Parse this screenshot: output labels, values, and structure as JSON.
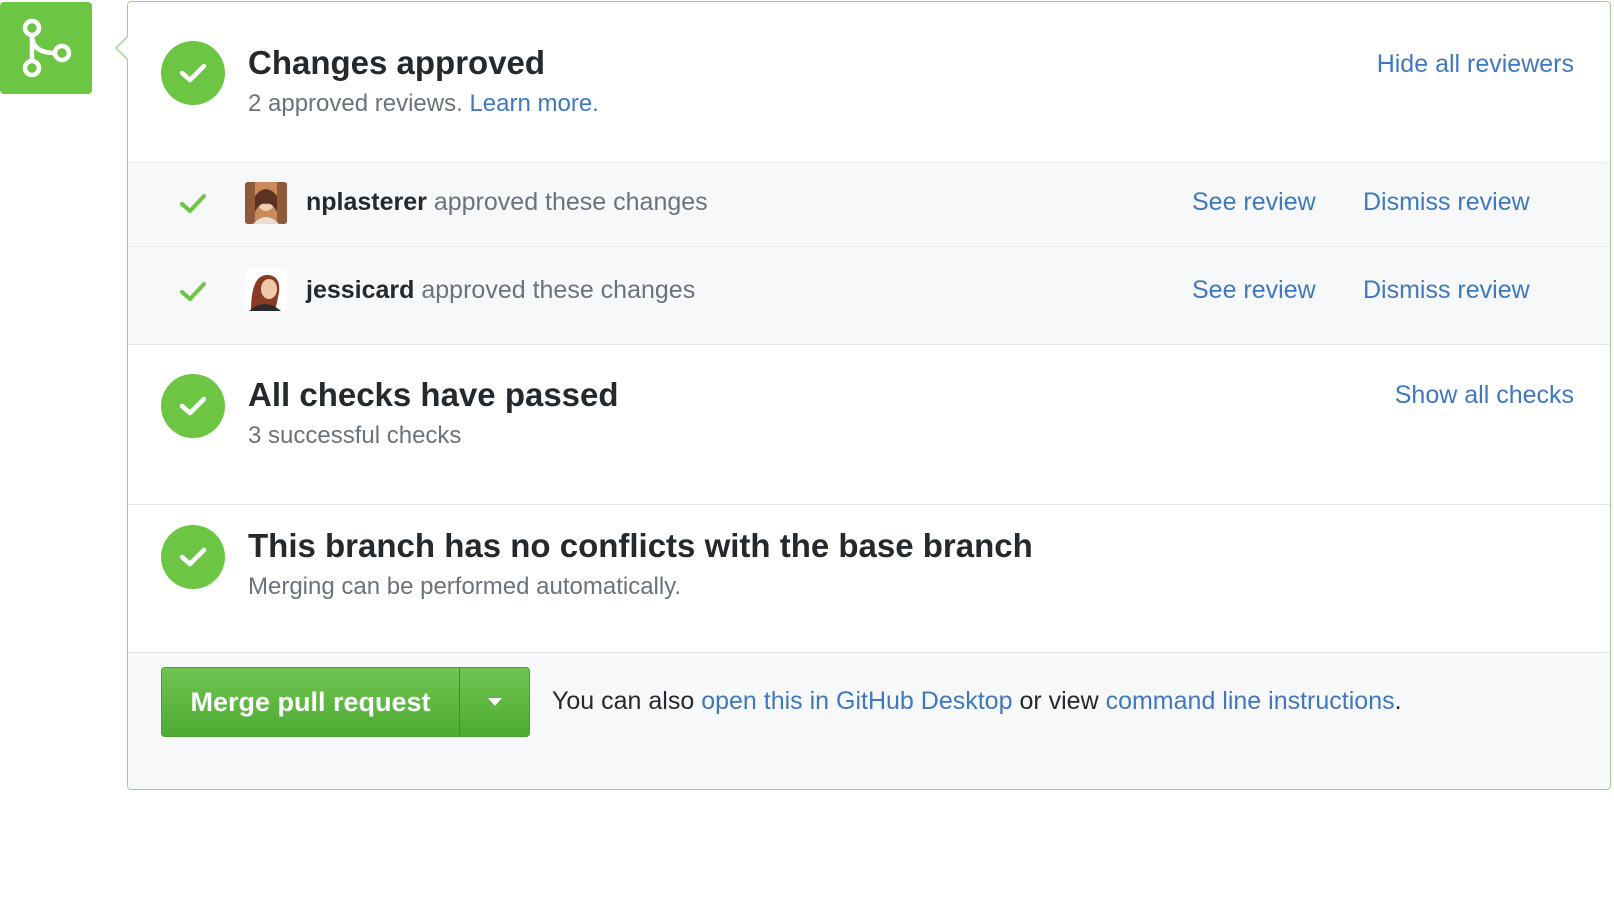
{
  "colors": {
    "success": "#6cc644",
    "link": "#4078c0",
    "border": "#9fd38a"
  },
  "badge": {
    "icon": "git-merge-icon"
  },
  "approvals": {
    "title": "Changes approved",
    "subtitle": "2 approved reviews.",
    "learn_more": "Learn more.",
    "toggle_link": "Hide all reviewers"
  },
  "reviews": [
    {
      "user": "nplasterer",
      "action": "approved these changes",
      "see": "See review",
      "dismiss": "Dismiss review"
    },
    {
      "user": "jessicard",
      "action": "approved these changes",
      "see": "See review",
      "dismiss": "Dismiss review"
    }
  ],
  "checks": {
    "title": "All checks have passed",
    "subtitle": "3 successful checks",
    "toggle_link": "Show all checks"
  },
  "conflicts": {
    "title": "This branch has no conflicts with the base branch",
    "subtitle": "Merging can be performed automatically."
  },
  "merge": {
    "button_label": "Merge pull request",
    "note_prefix": "You can also",
    "desktop_link": "open this in GitHub Desktop",
    "note_middle": "or view",
    "cli_link": "command line instructions",
    "note_suffix": "."
  }
}
